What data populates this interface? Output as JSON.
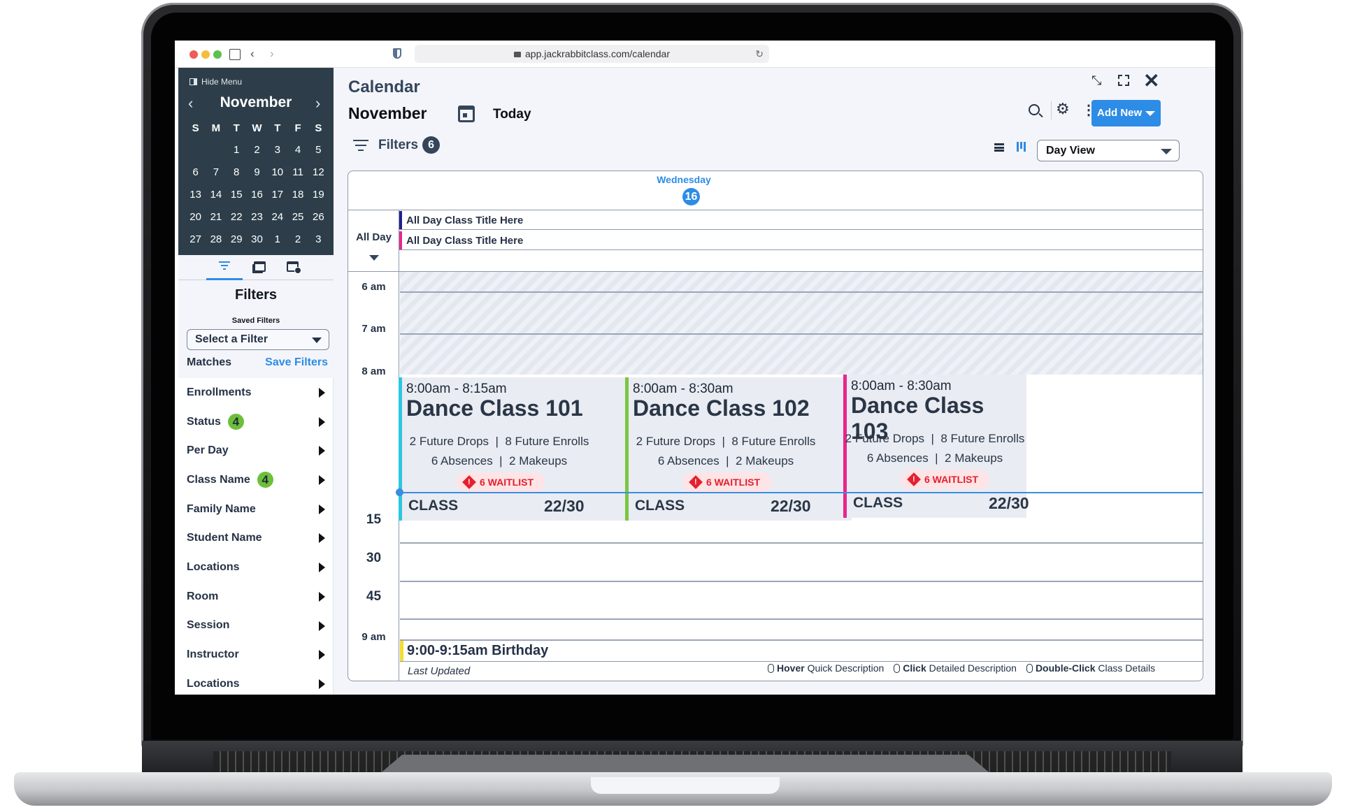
{
  "browser": {
    "url": "app.jackrabbitclass.com/calendar",
    "traffic_lights": {
      "close": "#ec5d56",
      "minimize": "#f4bd3f",
      "maximize": "#5cc04f"
    }
  },
  "sidebar": {
    "hide_menu_label": "Hide Menu",
    "mini_calendar": {
      "month": "November",
      "days_of_week": [
        "S",
        "M",
        "T",
        "W",
        "T",
        "F",
        "S"
      ],
      "weeks": [
        [
          "",
          "",
          "1",
          "2",
          "3",
          "4",
          "5"
        ],
        [
          "6",
          "7",
          "8",
          "9",
          "10",
          "11",
          "12"
        ],
        [
          "13",
          "14",
          "15",
          "16",
          "17",
          "18",
          "19"
        ],
        [
          "20",
          "21",
          "22",
          "23",
          "24",
          "25",
          "26"
        ],
        [
          "27",
          "28",
          "29",
          "30",
          "1",
          "2",
          "3"
        ]
      ]
    },
    "tabs": [
      {
        "icon": "filter-icon",
        "active": true
      },
      {
        "icon": "calendar-stack-icon",
        "active": false
      },
      {
        "icon": "calendar-clock-icon",
        "active": false
      }
    ],
    "filters_title": "Filters",
    "saved_filters_label": "Saved Filters",
    "select_filter_placeholder": "Select a Filter",
    "matches_label": "Matches",
    "save_filters_label": "Save Filters",
    "filter_items": [
      {
        "label": "Enrollments",
        "badge": null
      },
      {
        "label": "Status",
        "badge": "4"
      },
      {
        "label": "Per Day",
        "badge": null
      },
      {
        "label": "Class Name",
        "badge": "4"
      },
      {
        "label": "Family Name",
        "badge": null
      },
      {
        "label": "Student Name",
        "badge": null
      },
      {
        "label": "Locations",
        "badge": null
      },
      {
        "label": "Room",
        "badge": null
      },
      {
        "label": "Session",
        "badge": null
      },
      {
        "label": "Instructor",
        "badge": null
      },
      {
        "label": "Locations",
        "badge": null
      }
    ]
  },
  "header": {
    "title": "Calendar",
    "month": "November",
    "today_label": "Today",
    "filters_label": "Filters",
    "filters_count": "6",
    "add_new_label": "Add New",
    "view_select_value": "Day View",
    "accent_color": "#2d8ce6"
  },
  "calendar": {
    "day_name": "Wednesday",
    "day_number": "16",
    "all_day_label": "All Day",
    "all_day_events": [
      {
        "title": "All Day Class Title Here",
        "color": "#1f1f8f"
      },
      {
        "title": "All Day Class Title Here",
        "color": "#e8268e"
      }
    ],
    "time_labels": [
      "6 am",
      "7 am",
      "8 am",
      "15",
      "30",
      "45",
      "9 am"
    ],
    "classes": [
      {
        "time": "8:00am - 8:15am",
        "title": "Dance Class 101",
        "line1": "2 Future Drops  |  8 Future Enrolls",
        "line2": "6 Absences  |  2 Makeups",
        "waitlist": "6 WAITLIST",
        "type": "CLASS",
        "enrollment": "22/30",
        "color": "#2cc6e0"
      },
      {
        "time": "8:00am - 8:30am",
        "title": "Dance Class 102",
        "line1": "2 Future Drops  |  8 Future Enrolls",
        "line2": "6 Absences  |  2 Makeups",
        "waitlist": "6 WAITLIST",
        "type": "CLASS",
        "enrollment": "22/30",
        "color": "#7cc642"
      },
      {
        "time": "8:00am - 8:30am",
        "title": "Dance Class 103",
        "line1": "2 Future Drops  |  8 Future Enrolls",
        "line2": "6 Absences  |  2 Makeups",
        "waitlist": "6 WAITLIST",
        "type": "CLASS",
        "enrollment": "22/30",
        "color": "#e8268e"
      }
    ],
    "birthday_event": {
      "title": "9:00-9:15am Birthday",
      "color": "#f2de2e"
    },
    "last_updated_label": "Last Updated",
    "legend": [
      {
        "action": "Hover",
        "description": "Quick Description"
      },
      {
        "action": "Click",
        "description": "Detailed Description"
      },
      {
        "action": "Double-Click",
        "description": "Class Details"
      }
    ]
  }
}
